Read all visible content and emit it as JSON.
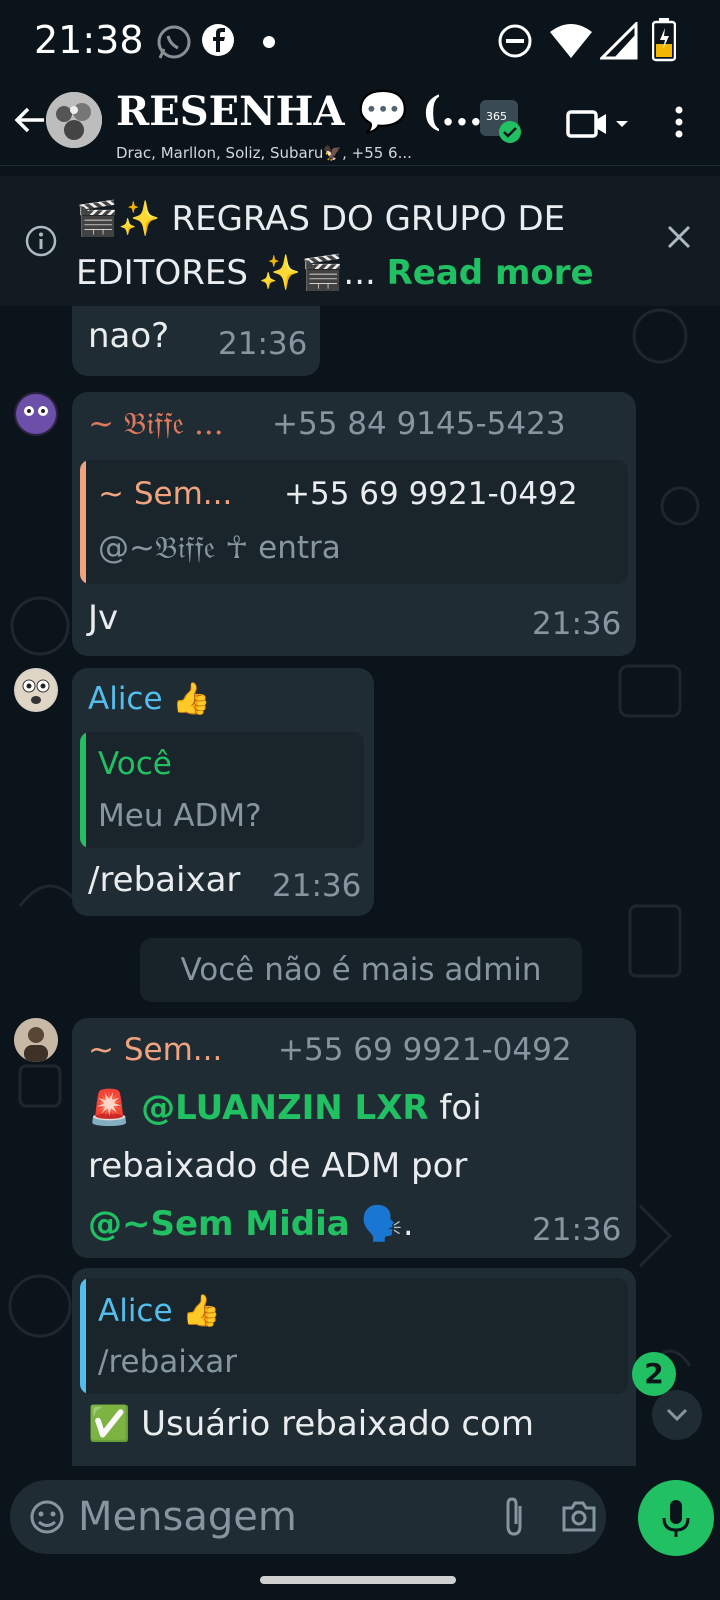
{
  "status_bar": {
    "time": "21:38"
  },
  "header": {
    "title": "RESENHA 💬 (...",
    "subtitle": "Drac, Marllon, Soliz, Subaru🦅, +55 6..."
  },
  "pinned": {
    "text": "🎬✨ REGRAS DO GRUPO DE EDITORES ✨🎬...",
    "read_more": "Read more"
  },
  "messages": [
    {
      "text": "nao?",
      "time": "21:36"
    },
    {
      "sender": "~ 𝔅𝔦𝔣𝔣𝔢 ...",
      "phone": "+55 84 9145-5423",
      "quote_sender": "~ Sem...",
      "quote_phone": "+55 69 9921-0492",
      "quote_text": "@~𝔅𝔦𝔣𝔣𝔢 ☥ entra",
      "text": "Jv",
      "time": "21:36"
    },
    {
      "sender": "Alice 👍",
      "quote_sender": "Você",
      "quote_text": "Meu ADM?",
      "text": "/rebaixar",
      "time": "21:36"
    },
    {
      "sender": "~ Sem...",
      "phone": "+55 69 9921-0492",
      "emoji": "🚨",
      "mention1": "@LUANZIN LXR",
      "text1": " foi",
      "text2": "rebaixado de ADM por",
      "mention2": "@~Sem Midia",
      "text3": " 🗣️.",
      "time": "21:36"
    },
    {
      "quote_sender": "Alice 👍",
      "quote_text": "/rebaixar",
      "text": "✅ Usuário rebaixado com"
    }
  ],
  "system_message": "Você não é mais admin",
  "unread_count": "2",
  "input": {
    "placeholder": "Mensagem"
  },
  "colors": {
    "background": "#0b141a",
    "bubble": "#202c33",
    "accent": "#21c063",
    "biffe": "#e07a5f",
    "alice": "#53bdeb",
    "sem": "#f0a37f"
  }
}
